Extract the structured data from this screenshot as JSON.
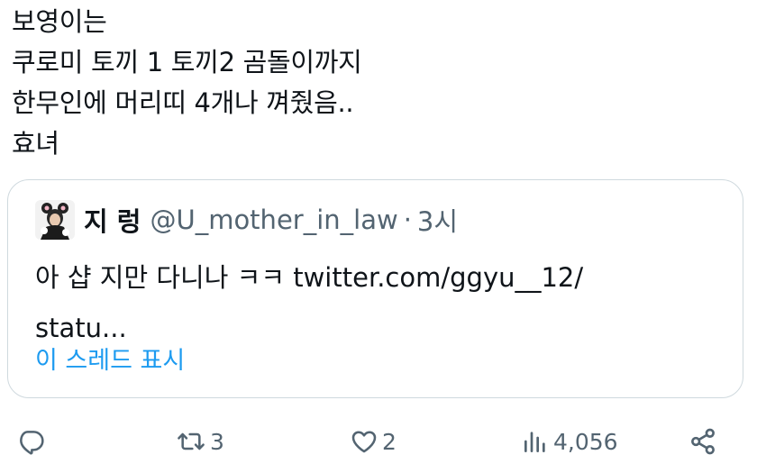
{
  "tweet": {
    "lines": [
      "보영이는",
      "쿠로미 토끼 1 토끼2 곰돌이까지",
      "한무인에 머리띠 4개나 껴줬음..",
      "효녀"
    ]
  },
  "quote": {
    "name": "지 렁",
    "handle": "@U_mother_in_law",
    "dot": "·",
    "time": "3시",
    "text_lines": [
      "아 샵 지만 다니나 ㅋㅋ twitter.com/ggyu__12/",
      "statu..."
    ],
    "show_thread": "이 스레드 표시"
  },
  "actions": {
    "reply_icon": "reply-icon",
    "retweet_count": "3",
    "like_count": "2",
    "views_count": "4,056",
    "share_icon": "share-icon"
  },
  "colors": {
    "text": "#0f1419",
    "secondary": "#536471",
    "link": "#1d9bf0",
    "border": "#cfd9de"
  }
}
